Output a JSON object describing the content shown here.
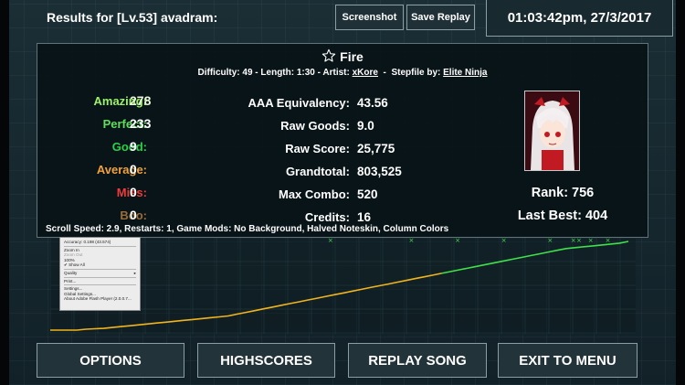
{
  "header": {
    "title": "Results for [Lv.53] avadram:",
    "screenshot_label": "Screenshot",
    "save_replay_label": "Save Replay",
    "datetime": "01:03:42pm, 27/3/2017"
  },
  "song": {
    "name": "Fire",
    "difficulty_label": "Difficulty: 49",
    "length_label": "Length: 1:30",
    "artist_prefix": "Artist:",
    "artist": "xKore",
    "stepfile_prefix": "Stepfile by:",
    "stepfile_author": "Elite Ninja"
  },
  "judgements": [
    {
      "label": "Amazing:",
      "value": "278",
      "color": "#9cf26a"
    },
    {
      "label": "Perfect:",
      "value": "233",
      "color": "#5ee05b"
    },
    {
      "label": "Good:",
      "value": "9",
      "color": "#2bd14a"
    },
    {
      "label": "Average:",
      "value": "0",
      "color": "#f2a13a"
    },
    {
      "label": "Miss:",
      "value": "0",
      "color": "#ef3b3b"
    },
    {
      "label": "Boo:",
      "value": "0",
      "color": "#9a6d3a"
    }
  ],
  "stats": [
    {
      "label": "AAA Equivalency:",
      "value": "43.56"
    },
    {
      "label": "Raw Goods:",
      "value": "9.0"
    },
    {
      "label": "Raw Score:",
      "value": "25,775"
    },
    {
      "label": "Grandtotal:",
      "value": "803,525"
    },
    {
      "label": "Max Combo:",
      "value": "520"
    },
    {
      "label": "Credits:",
      "value": "16"
    }
  ],
  "rank": {
    "rank_text": "Rank: 756",
    "last_best_text": "Last Best: 404",
    "avatar_icon": "player-avatar"
  },
  "scroll_info": "Scroll Speed: 2.9, Restarts: 1, Game Mods: No Background, Halved Noteskin, Column Colors",
  "context_menu": {
    "items": [
      "Accuracy: 0.198 (43.574)",
      "Zoom In",
      "Zoom Out",
      "100%",
      "Show All",
      "Quality",
      "Print...",
      "Settings...",
      "Global Settings...",
      "About Adobe Flash Player (2.0.0.7..."
    ]
  },
  "graph_data": {
    "series": [
      {
        "color": "#f0b41c",
        "values": [
          0,
          0,
          0,
          0,
          1,
          1.5,
          2,
          3,
          4,
          5,
          6,
          7,
          8,
          9,
          10,
          11,
          12,
          13,
          14,
          15,
          16,
          18,
          20,
          22,
          24,
          26,
          28,
          30,
          32,
          34,
          36,
          38,
          40,
          42,
          44,
          46,
          48,
          50,
          52,
          54,
          56,
          58,
          60,
          62,
          64,
          66,
          68,
          70,
          72,
          74,
          76,
          78,
          80,
          82,
          84,
          86,
          88,
          90,
          92,
          93,
          94,
          95,
          96,
          97,
          98,
          100
        ]
      }
    ],
    "split_index": 44,
    "late_color": "#3fe04a",
    "miss_marks": [
      0.48,
      0.62,
      0.7,
      0.78,
      0.86,
      0.9,
      0.91,
      0.93,
      0.96
    ],
    "grid_color": "#3a5a60"
  },
  "buttons": {
    "options": "OPTIONS",
    "highscores": "HIGHSCORES",
    "replay_song": "REPLAY SONG",
    "exit_to_menu": "EXIT TO MENU"
  }
}
